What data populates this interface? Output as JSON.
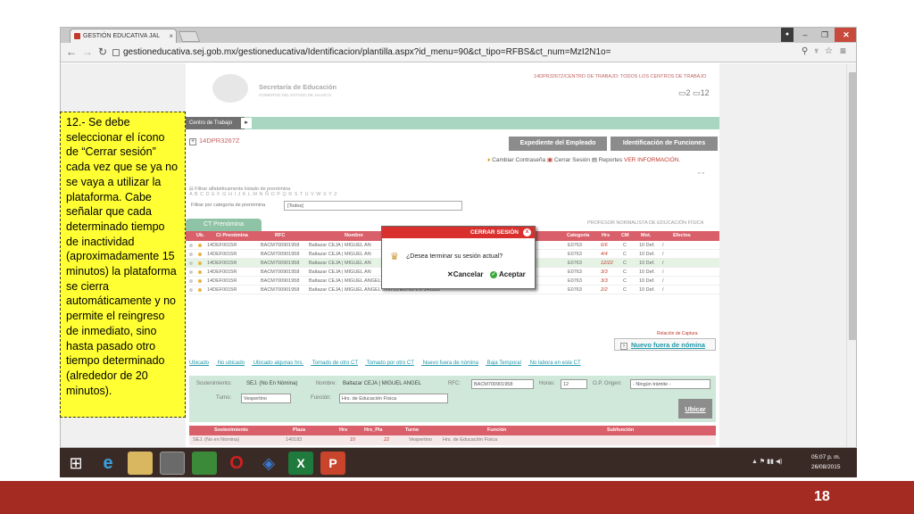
{
  "browser": {
    "tab_title": "GESTIÓN EDUCATIVA JAL",
    "tab_close": "×",
    "window_user_icon": "user-icon",
    "win_min": "–",
    "win_max": "❐",
    "win_close": "✕",
    "url": "gestioneducativa.sej.gob.mx/gestioneducativa/Identificacion/plantilla.aspx?id_menu=90&ct_tipo=RFBS&ct_num=MzI2N1o="
  },
  "page": {
    "header_top": "14DPR3267Z/CENTRO DE TRABAJO: TODOS LOS CENTROS DE TRABAJO",
    "secretaria": "Secretaría de Educación",
    "gobierno": "GOBIERNO DEL ESTADO DE JALISCO",
    "header_count": "2",
    "header_count2": "12",
    "ct_label": "Centro de Trabajo",
    "ct_code": "14DPR3267Z",
    "btn_expediente": "Expediente del Empleado",
    "btn_funciones": "Identificación de Funciones",
    "menu_cambiar": "Cambiar Contraseña",
    "menu_cerrar": "Cerrar Sesión",
    "menu_reportes": "Reportes",
    "menu_ver": "VER INFORMACIÓN.",
    "filter_alpha": "Filtrar alfabéticamente listado de prenómina",
    "alphabet": "A B C D E F G H I J K L M N Ñ O P Q R S T U V W X Y Z",
    "filter_cat": "Filtrar por categoría de prenómina",
    "filter_select": "[Todos]",
    "tab_ct_premomina": "CT Prenómina",
    "profesor_label": "PROFESOR NORMALISTA DE EDUCACIÓN FÍSICA",
    "reloj": "Relación de Captura",
    "nuevo_fuera": "Nuevo fuera de nómina"
  },
  "table": {
    "headers": [
      "Ub.",
      "Ct Prenómina",
      "RFC",
      "Nombre",
      "Categoría",
      "Hrs",
      "CM",
      "Mot.",
      "Efectos"
    ],
    "rows": [
      {
        "ct": "14DEF0015R",
        "rfc": "BACM700901958",
        "nombre": "Baltazar CEJA | MIGUEL AN",
        "cat": "E0763",
        "hrs": "6/6",
        "cm": "C",
        "mot": "10 Def.",
        "ef": "/"
      },
      {
        "ct": "14DEF0015R",
        "rfc": "BACM700901958",
        "nombre": "Baltazar CEJA | MIGUEL AN",
        "cat": "E0763",
        "hrs": "4/4",
        "cm": "C",
        "mot": "10 Def.",
        "ef": "/"
      },
      {
        "ct": "14DEF0015R",
        "rfc": "BACM700901958",
        "nombre": "Baltazar CEJA | MIGUEL AN",
        "cat": "E0763",
        "hrs": "12/22",
        "cm": "C",
        "mot": "10 Def.",
        "ef": "/"
      },
      {
        "ct": "14DEF0015R",
        "rfc": "BACM700901958",
        "nombre": "Baltazar CEJA | MIGUEL AN",
        "cat": "E0763",
        "hrs": "3/3",
        "cm": "C",
        "mot": "10 Def.",
        "ef": "/"
      },
      {
        "ct": "14DEF0015R",
        "rfc": "BACM700901958",
        "nombre": "Baltazar CEJA | MIGUEL ANGEL 076715 E0763 2.0 141343",
        "cat": "E0763",
        "hrs": "3/3",
        "cm": "C",
        "mot": "10 Def.",
        "ef": "/"
      },
      {
        "ct": "14DEF0015R",
        "rfc": "BACM700901958",
        "nombre": "Baltazar CEJA | MIGUEL ANGEL 076715 E0763 2.0 141351",
        "cat": "E0763",
        "hrs": "2/2",
        "cm": "C",
        "mot": "10 Def.",
        "ef": "/"
      }
    ]
  },
  "legend": [
    "Ubicado",
    "No ubicado",
    "Ubicado algunas hrs.",
    "Tomado de otro CT",
    "Tomado por otro CT",
    "Nuevo fuera de nómina",
    "Baja Temporal",
    "No labora en este CT"
  ],
  "form": {
    "sostenimiento_label": "Sostenimiento:",
    "sostenimiento_val": "SEJ. (No En Nómina)",
    "nombre_label": "Nombre:",
    "nombre_val": "Baltazar CEJA | MIGUEL ANGEL",
    "rfc_label": "RFC:",
    "rfc_val": "BACM700901958",
    "horas_label": "Horas:",
    "horas_val": "12",
    "origen_label": "O.P. Origen:",
    "origen_val": "- Ningún trámite -",
    "turno_label": "Turno:",
    "turno_val": "Vespertino",
    "funcion_label": "Función:",
    "funcion_val": "Hrs. de Educación Física",
    "ubicar": "Ubicar"
  },
  "table2": {
    "headers": [
      "Sostenimiento",
      "Plaza",
      "Hrs",
      "Hrs_Pla",
      "Turno",
      "Función",
      "Subfunción"
    ],
    "row": [
      "SEJ. (No en Nómina)",
      "140183",
      "10",
      "22",
      "Vespertino",
      "Hrs. de Educación Física",
      ""
    ]
  },
  "modal": {
    "title": "CERRAR SESIÓN",
    "question": "¿Desea terminar su sesión actual?",
    "cancel": "Cancelar",
    "accept": "Aceptar"
  },
  "callout": "12.- Se debe seleccionar el ícono de “Cerrar sesión” cada vez que se ya no se vaya a utilizar la plataforma. Cabe señalar que cada determinado tiempo de inactividad (aproximadamente 15 minutos) la plataforma se cierra automáticamente y no permite el reingreso de inmediato, sino hasta pasado otro tiempo determinado (alrededor de 20 minutos).",
  "taskbar": {
    "time": "05:07 p. m.",
    "date": "26/08/2015"
  },
  "slide_number": "18",
  "colors": {
    "accent_red": "#a42b22",
    "callout_yellow": "#ffff33",
    "table_header": "#d9606a",
    "green_bar": "#a9d6c0"
  }
}
